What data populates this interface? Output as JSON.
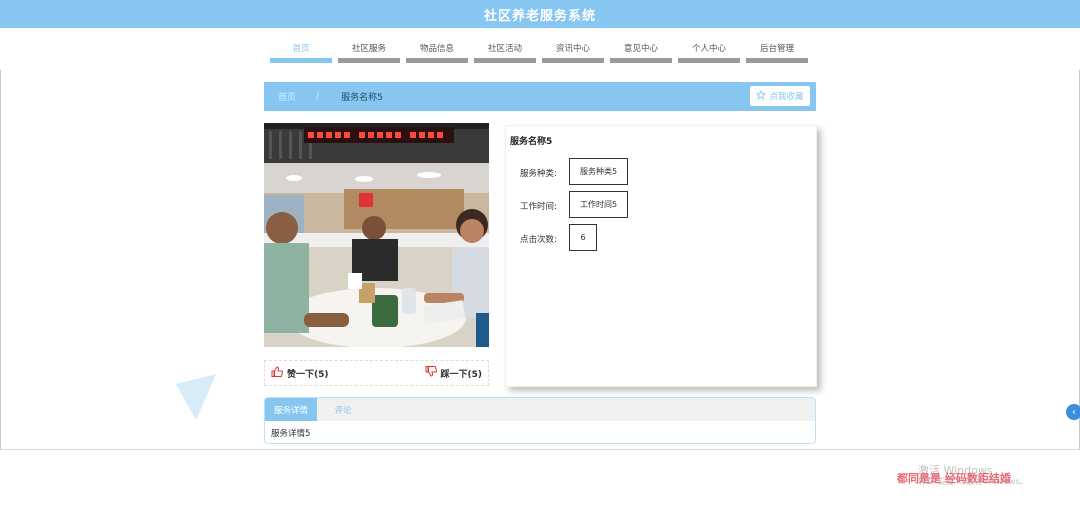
{
  "header": {
    "title": "社区养老服务系统"
  },
  "nav": [
    {
      "label": "首页",
      "active": true
    },
    {
      "label": "社区服务",
      "active": false
    },
    {
      "label": "物品信息",
      "active": false
    },
    {
      "label": "社区活动",
      "active": false
    },
    {
      "label": "资讯中心",
      "active": false
    },
    {
      "label": "意见中心",
      "active": false
    },
    {
      "label": "个人中心",
      "active": false
    },
    {
      "label": "后台管理",
      "active": false
    }
  ],
  "breadcrumb": {
    "home": "首页",
    "separator": "/",
    "current": "服务名称5",
    "favorite_label": "点我收藏"
  },
  "vote": {
    "like_label": "赞一下(5)",
    "dislike_label": "踩一下(5)"
  },
  "detail": {
    "name": "服务名称5",
    "rows": [
      {
        "label": "服务种类:",
        "value": "服务种类5"
      },
      {
        "label": "工作时间:",
        "value": "工作时间5"
      },
      {
        "label": "点击次数:",
        "value": "6"
      }
    ]
  },
  "tabs": {
    "items": [
      {
        "label": "服务详情",
        "active": true
      },
      {
        "label": "评论",
        "active": false
      }
    ],
    "content": "服务详情5"
  },
  "overlay": {
    "watermark_line1": "激活 Windows",
    "watermark_line2": "转到\"设置\"以激活 Windows。",
    "stamp": "都同是是 经码数距结婚"
  },
  "colors": {
    "accent": "#86c6f0",
    "nav_inactive_bar": "#9b9b9b"
  },
  "icons": {
    "favorite": "star-outline-icon",
    "like": "thumbs-up-icon",
    "dislike": "thumbs-down-icon",
    "side": "chevron-left-icon"
  }
}
